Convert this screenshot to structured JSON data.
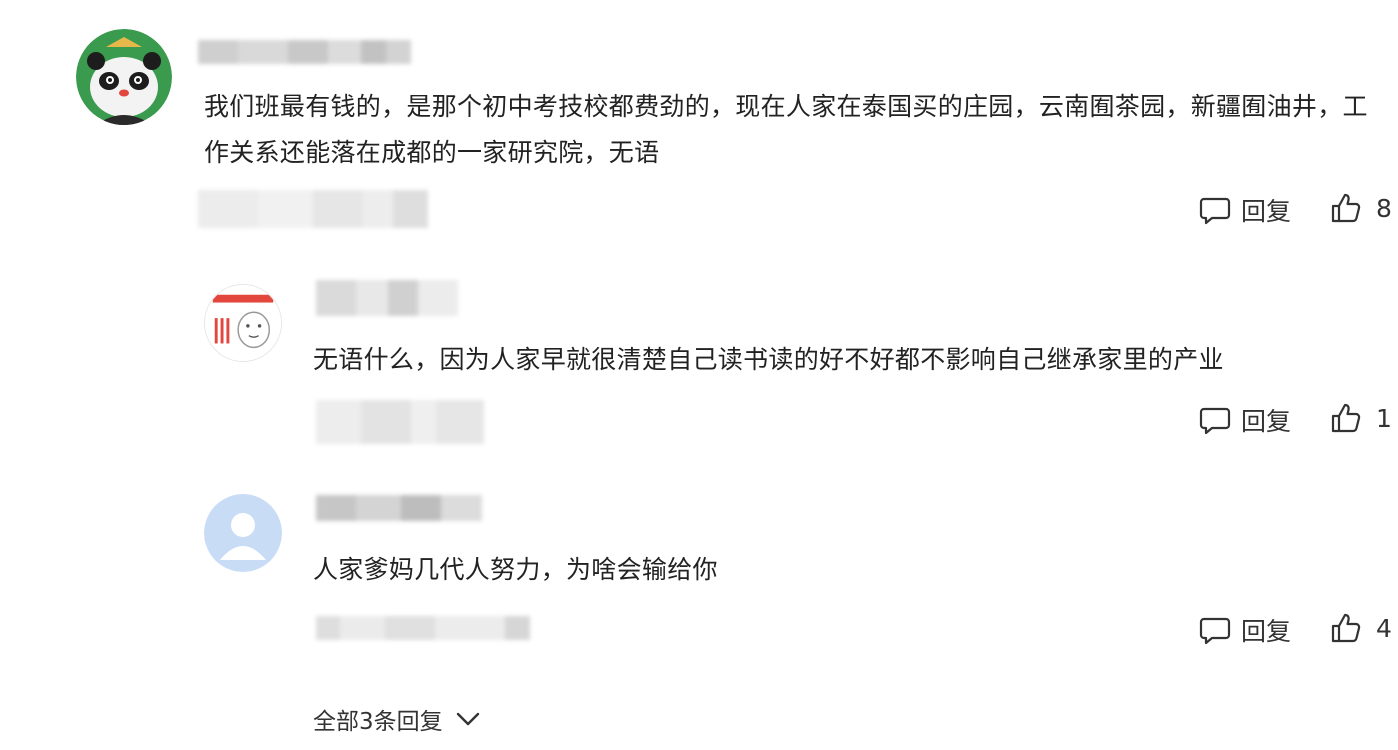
{
  "comments": [
    {
      "text": "我们班最有钱的，是那个初中考技校都费劲的，现在人家在泰国买的庄园，云南囿茶园，新疆囿油井，工作关系还能落在成都的一家研究院，无语",
      "reply_label": "回复",
      "like_count": "8",
      "avatar_icon": "panda-avatar"
    },
    {
      "text": "无语什么，因为人家早就很清楚自己读书读的好不好都不影响自己继承家里的产业",
      "reply_label": "回复",
      "like_count": "1",
      "avatar_icon": "cartoon-avatar"
    },
    {
      "text": "人家爹妈几代人努力，为啥会输给你",
      "reply_label": "回复",
      "like_count": "4",
      "avatar_icon": "default-user-avatar"
    }
  ],
  "expand_label": "全部3条回复",
  "colors": {
    "panda_bg": "#3a9a4e",
    "default_avatar_bg": "#c9dcf6",
    "mosaic_gray": "#d8d8d8"
  }
}
